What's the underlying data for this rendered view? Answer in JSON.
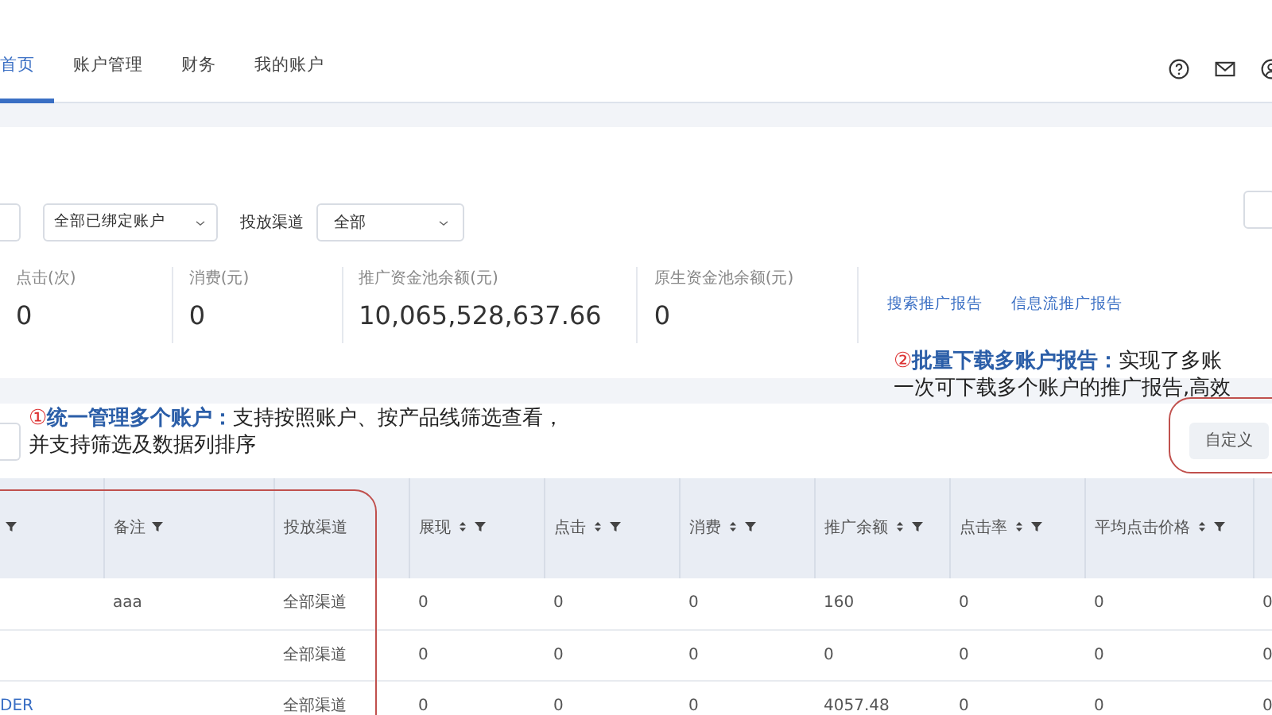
{
  "nav": {
    "tabs": [
      {
        "label": "首页",
        "selected": true
      },
      {
        "label": "账户管理",
        "selected": false
      },
      {
        "label": "财务",
        "selected": false
      },
      {
        "label": "我的账户",
        "selected": false
      }
    ]
  },
  "filters": {
    "account_select": "全部已绑定账户",
    "channel_label": "投放渠道",
    "channel_select": "全部"
  },
  "stats": [
    {
      "label": "点击(次)",
      "value": "0"
    },
    {
      "label": "消费(元)",
      "value": "0"
    },
    {
      "label": "推广资金池余额(元)",
      "value": "10,065,528,637.66"
    },
    {
      "label": "原生资金池余额(元)",
      "value": "0"
    }
  ],
  "report_links": [
    "搜索推广报告",
    "信息流推广报告"
  ],
  "annotations": [
    {
      "number": "①",
      "text": "**统一管理多个账户：**支持按照账户、按产品线筛选查看，",
      "text_2": "并支持筛选及数据列排序"
    },
    {
      "number": "②",
      "text": "**批量下载多账户报告：**实现了多账",
      "text_2": "一次可下载多个账户的推广报告,高效"
    }
  ],
  "customize_button": "自定义",
  "table": {
    "columns": [
      {
        "kind": "link",
        "sortable": false,
        "filterable": true
      },
      {
        "kind": "text",
        "label": "备注",
        "sortable": false,
        "filterable": true
      },
      {
        "kind": "text",
        "label": "投放渠道",
        "sortable": false,
        "filterable": false
      },
      {
        "kind": "text",
        "label": "展现",
        "sortable": true,
        "filterable": true
      },
      {
        "kind": "text",
        "label": "点击",
        "sortable": true,
        "filterable": true
      },
      {
        "kind": "text",
        "label": "消费",
        "sortable": true,
        "filterable": true
      },
      {
        "kind": "text",
        "label": "推广余额",
        "sortable": true,
        "filterable": true
      },
      {
        "kind": "text",
        "label": "点击率",
        "sortable": true,
        "filterable": true
      },
      {
        "kind": "text",
        "label": "平均点击价格",
        "sortable": true,
        "filterable": true
      },
      {
        "kind": "text"
      }
    ],
    "rows": [
      [
        null,
        "aaa",
        "全部渠道",
        "0",
        "0",
        "0",
        "160",
        "0",
        "0",
        "0"
      ],
      [
        null,
        null,
        "全部渠道",
        "0",
        "0",
        "0",
        "0",
        "0",
        "0",
        "0"
      ],
      [
        "DER",
        null,
        "全部渠道",
        "0",
        "0",
        "0",
        "4057.48",
        "0",
        "0",
        "0"
      ]
    ]
  }
}
